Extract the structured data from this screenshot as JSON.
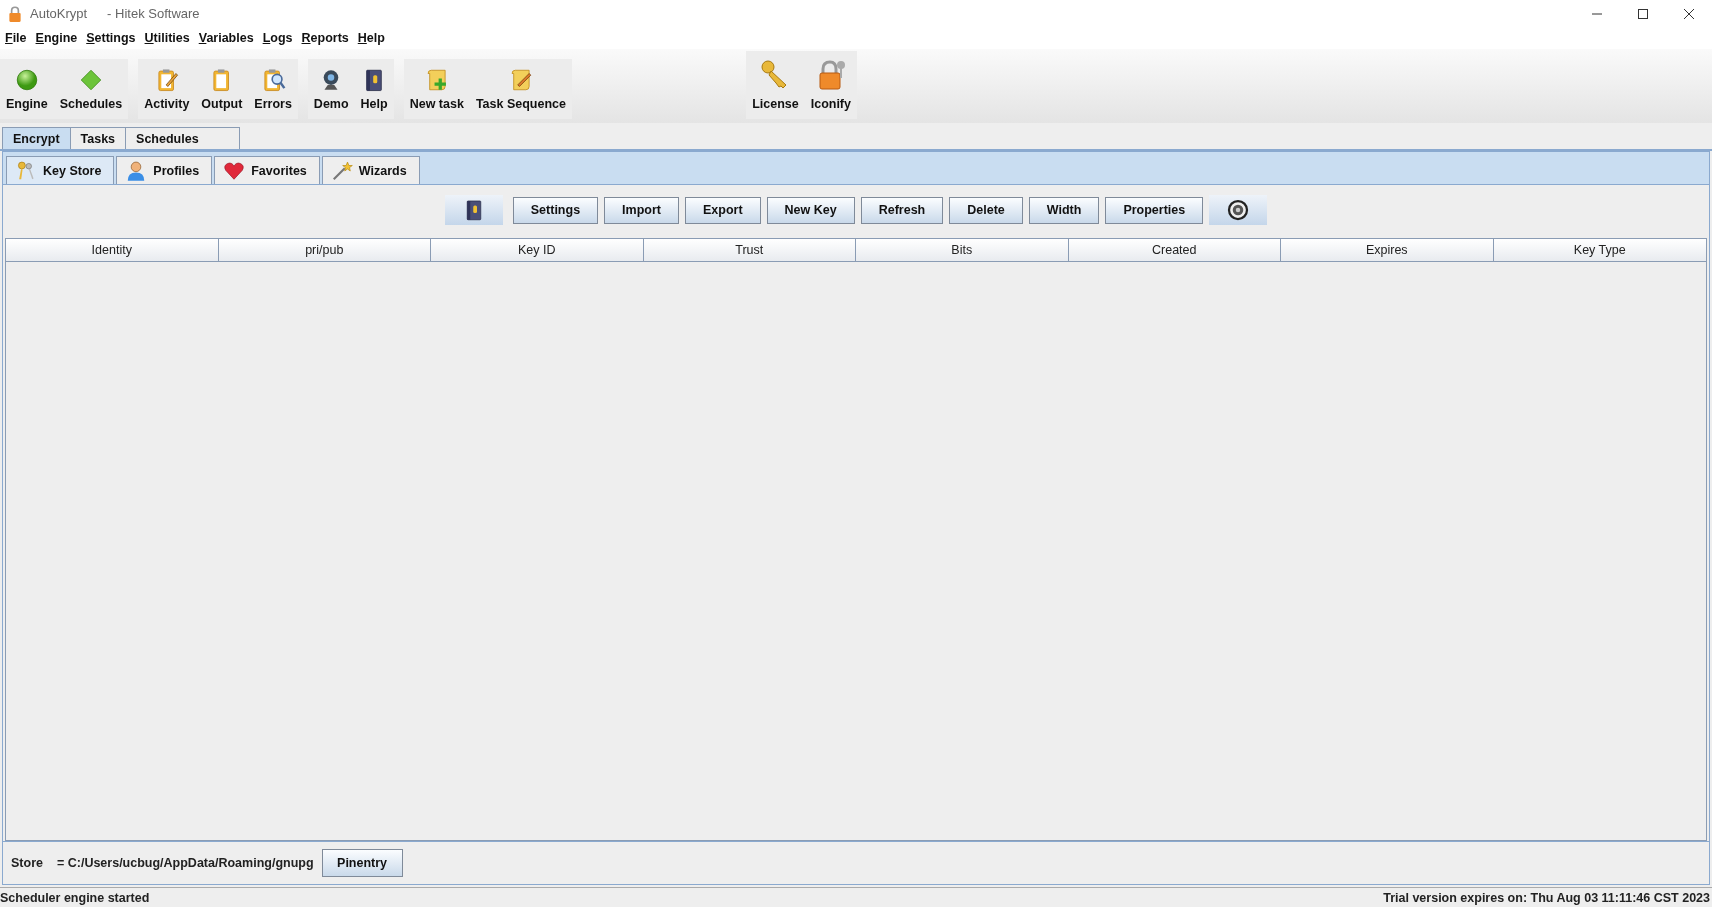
{
  "window": {
    "title": "AutoKrypt",
    "subtitle": "- Hitek Software"
  },
  "menu": [
    "File",
    "Engine",
    "Settings",
    "Utilities",
    "Variables",
    "Logs",
    "Reports",
    "Help"
  ],
  "toolbar_groups": [
    {
      "items": [
        {
          "label": "Engine"
        },
        {
          "label": "Schedules"
        }
      ]
    },
    {
      "items": [
        {
          "label": "Activity"
        },
        {
          "label": "Output"
        },
        {
          "label": "Errors"
        }
      ]
    },
    {
      "items": [
        {
          "label": "Demo"
        },
        {
          "label": "Help"
        }
      ]
    },
    {
      "items": [
        {
          "label": "New task"
        },
        {
          "label": "Task Sequence"
        }
      ]
    },
    {
      "items": [
        {
          "label": "License"
        },
        {
          "label": "Iconify"
        }
      ]
    }
  ],
  "main_tabs": [
    {
      "label": "Encrypt",
      "selected": true
    },
    {
      "label": "Tasks",
      "selected": false
    },
    {
      "label": "Schedules",
      "selected": false
    }
  ],
  "sub_tabs": [
    {
      "label": "Key Store",
      "selected": true
    },
    {
      "label": "Profiles",
      "selected": false
    },
    {
      "label": "Favorites",
      "selected": false
    },
    {
      "label": "Wizards",
      "selected": false
    }
  ],
  "key_toolbar": [
    {
      "kind": "icon"
    },
    {
      "kind": "text",
      "label": "Settings"
    },
    {
      "kind": "text",
      "label": "Import"
    },
    {
      "kind": "text",
      "label": "Export"
    },
    {
      "kind": "text",
      "label": "New Key"
    },
    {
      "kind": "text",
      "label": "Refresh"
    },
    {
      "kind": "text",
      "label": "Delete"
    },
    {
      "kind": "text",
      "label": "Width"
    },
    {
      "kind": "text",
      "label": "Properties"
    },
    {
      "kind": "icon"
    }
  ],
  "table": {
    "columns": [
      "Identity",
      "pri/pub",
      "Key ID",
      "Trust",
      "Bits",
      "Created",
      "Expires",
      "Key Type"
    ]
  },
  "store": {
    "label": "Store",
    "path": "= C:/Users/ucbug/AppData/Roaming/gnupg",
    "button": "Pinentry"
  },
  "status_bar": {
    "left": "Scheduler engine started",
    "right": "Trial version expires on: Thu Aug 03 11:11:46 CST 2023"
  }
}
